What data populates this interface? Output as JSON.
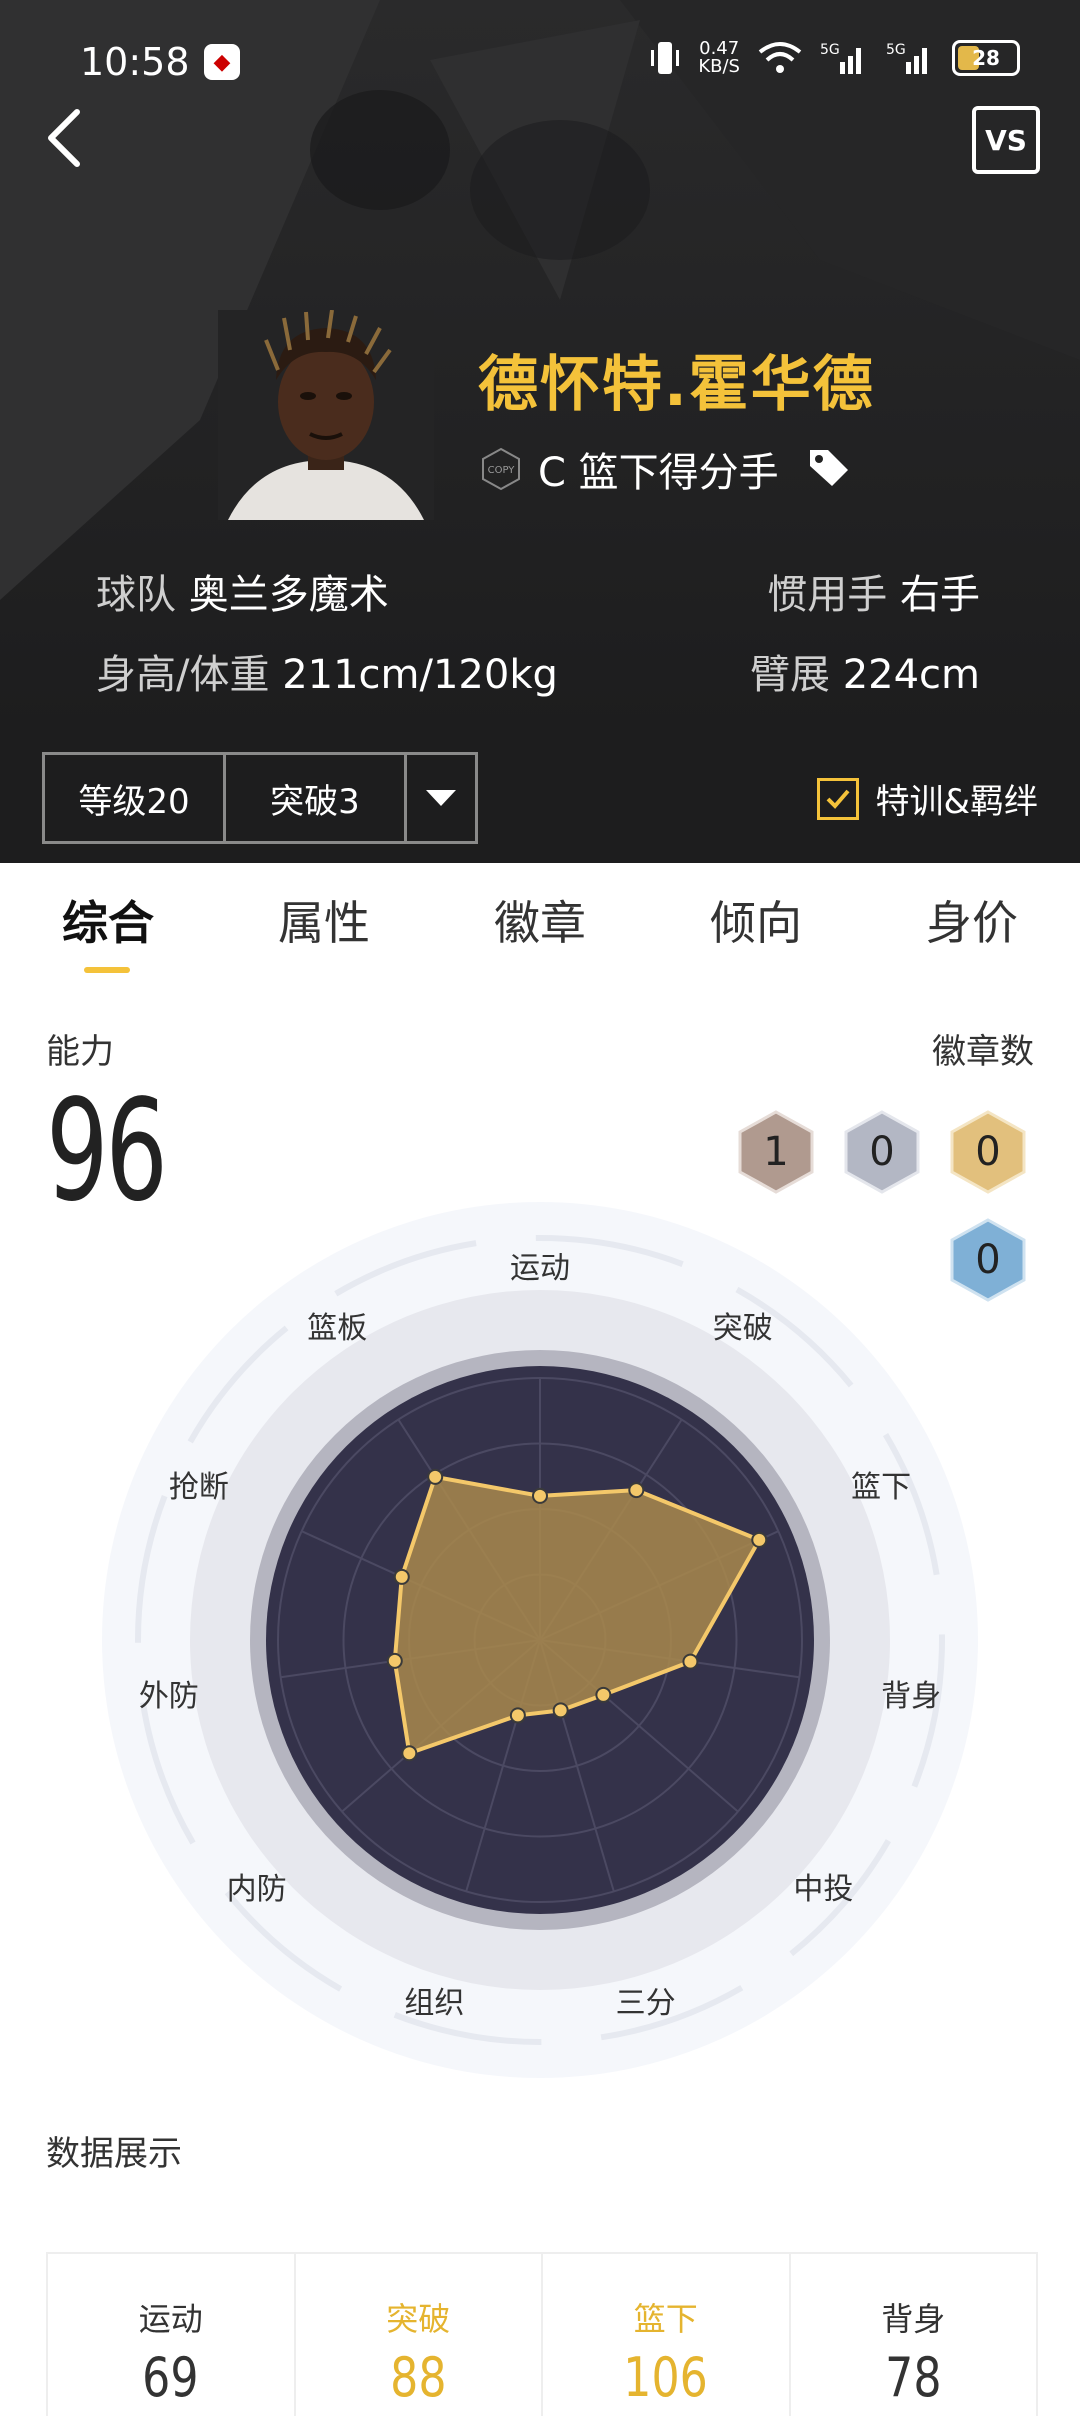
{
  "status_bar": {
    "time": "10:58",
    "net_speed": "0.47",
    "net_unit": "KB/S",
    "battery": "28"
  },
  "header": {
    "player_name": "德怀特.霍华德",
    "copy_label": "COPY",
    "position": "C 篮下得分手",
    "team_label": "球队",
    "team_value": "奥兰多魔术",
    "body_label": "身高/体重",
    "body_value": "211cm/120kg",
    "hand_label": "惯用手",
    "hand_value": "右手",
    "span_label": "臂展",
    "span_value": "224cm",
    "vs_label": "VS"
  },
  "controls": {
    "level": "等级20",
    "breakthrough": "突破3",
    "train_label": "特训&羁绊",
    "train_checked": true
  },
  "tabs": [
    "综合",
    "属性",
    "徽章",
    "倾向",
    "身价"
  ],
  "ability": {
    "label": "能力",
    "value": "96"
  },
  "badges": {
    "label": "徽章数",
    "items": [
      {
        "tier": "bronze",
        "count": "1",
        "color": "#b09a8f"
      },
      {
        "tier": "silver",
        "count": "0",
        "color": "#b3b7c4"
      },
      {
        "tier": "gold",
        "count": "0",
        "color": "#e2c07d"
      },
      {
        "tier": "hof",
        "count": "0",
        "color": "#7fb0d6"
      }
    ]
  },
  "radar": {
    "axes": [
      "运动",
      "突破",
      "篮下",
      "背身",
      "中投",
      "三分",
      "组织",
      "内防",
      "外防",
      "抢断",
      "篮板"
    ],
    "values": [
      0.55,
      0.68,
      0.92,
      0.58,
      0.32,
      0.28,
      0.3,
      0.66,
      0.56,
      0.58,
      0.74
    ],
    "fill_color": "#a9884c",
    "line_color": "#f4c86a",
    "bg_color": "#34324a"
  },
  "data_section": {
    "title": "数据展示",
    "stats": [
      {
        "label": "运动",
        "value": "69",
        "highlight": false
      },
      {
        "label": "突破",
        "value": "88",
        "highlight": true
      },
      {
        "label": "篮下",
        "value": "106",
        "highlight": true
      },
      {
        "label": "背身",
        "value": "78",
        "highlight": false
      }
    ]
  }
}
